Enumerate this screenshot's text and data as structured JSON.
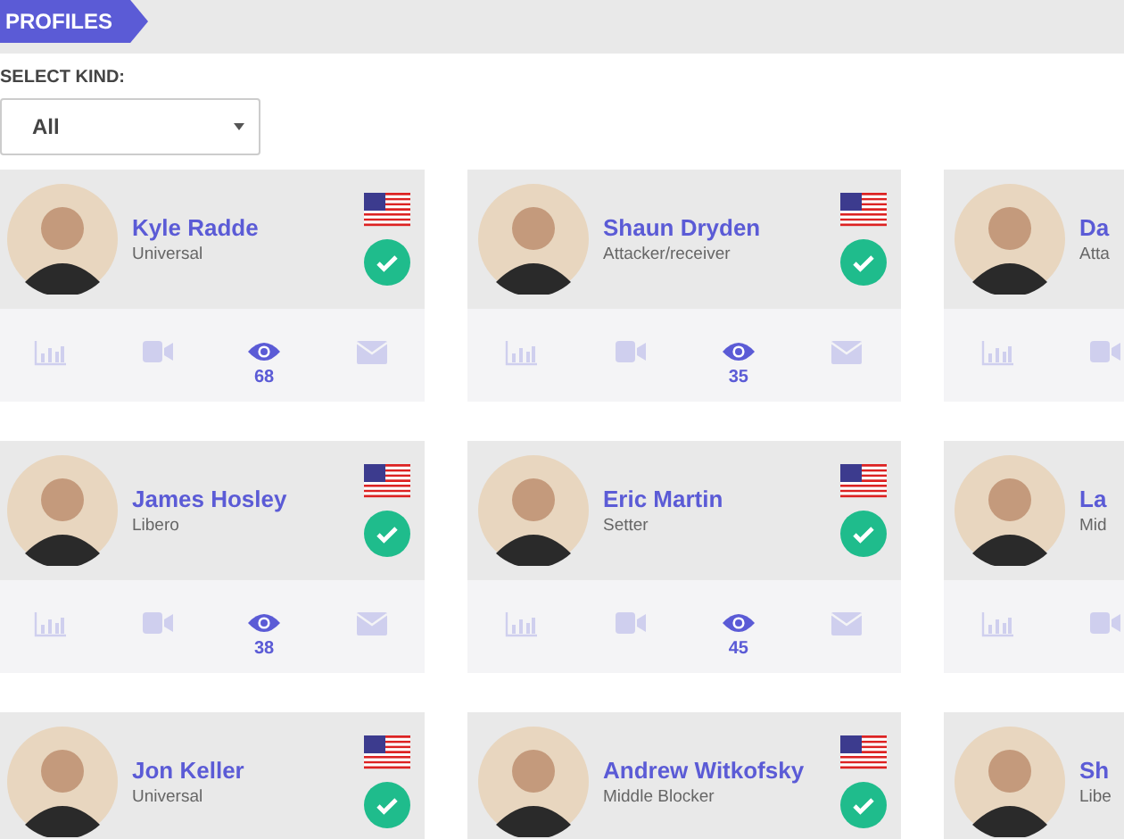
{
  "header": {
    "tab": "PROFILES"
  },
  "filter": {
    "label": "SELECT KIND:",
    "value": "All"
  },
  "profiles": [
    {
      "name": "Kyle Radde",
      "role": "Universal",
      "verified": true,
      "views": "68"
    },
    {
      "name": "Shaun Dryden",
      "role": "Attacker/receiver",
      "verified": true,
      "views": "35"
    },
    {
      "name": "Da",
      "role": "Atta"
    },
    {
      "name": "James Hosley",
      "role": "Libero",
      "verified": true,
      "views": "38"
    },
    {
      "name": "Eric Martin",
      "role": "Setter",
      "verified": true,
      "views": "45"
    },
    {
      "name": "La",
      "role": "Mid"
    },
    {
      "name": "Jon Keller",
      "role": "Universal",
      "verified": true
    },
    {
      "name": "Andrew Witkofsky",
      "role": "Middle Blocker",
      "verified": true
    },
    {
      "name": "Sh",
      "role": "Libe"
    }
  ]
}
